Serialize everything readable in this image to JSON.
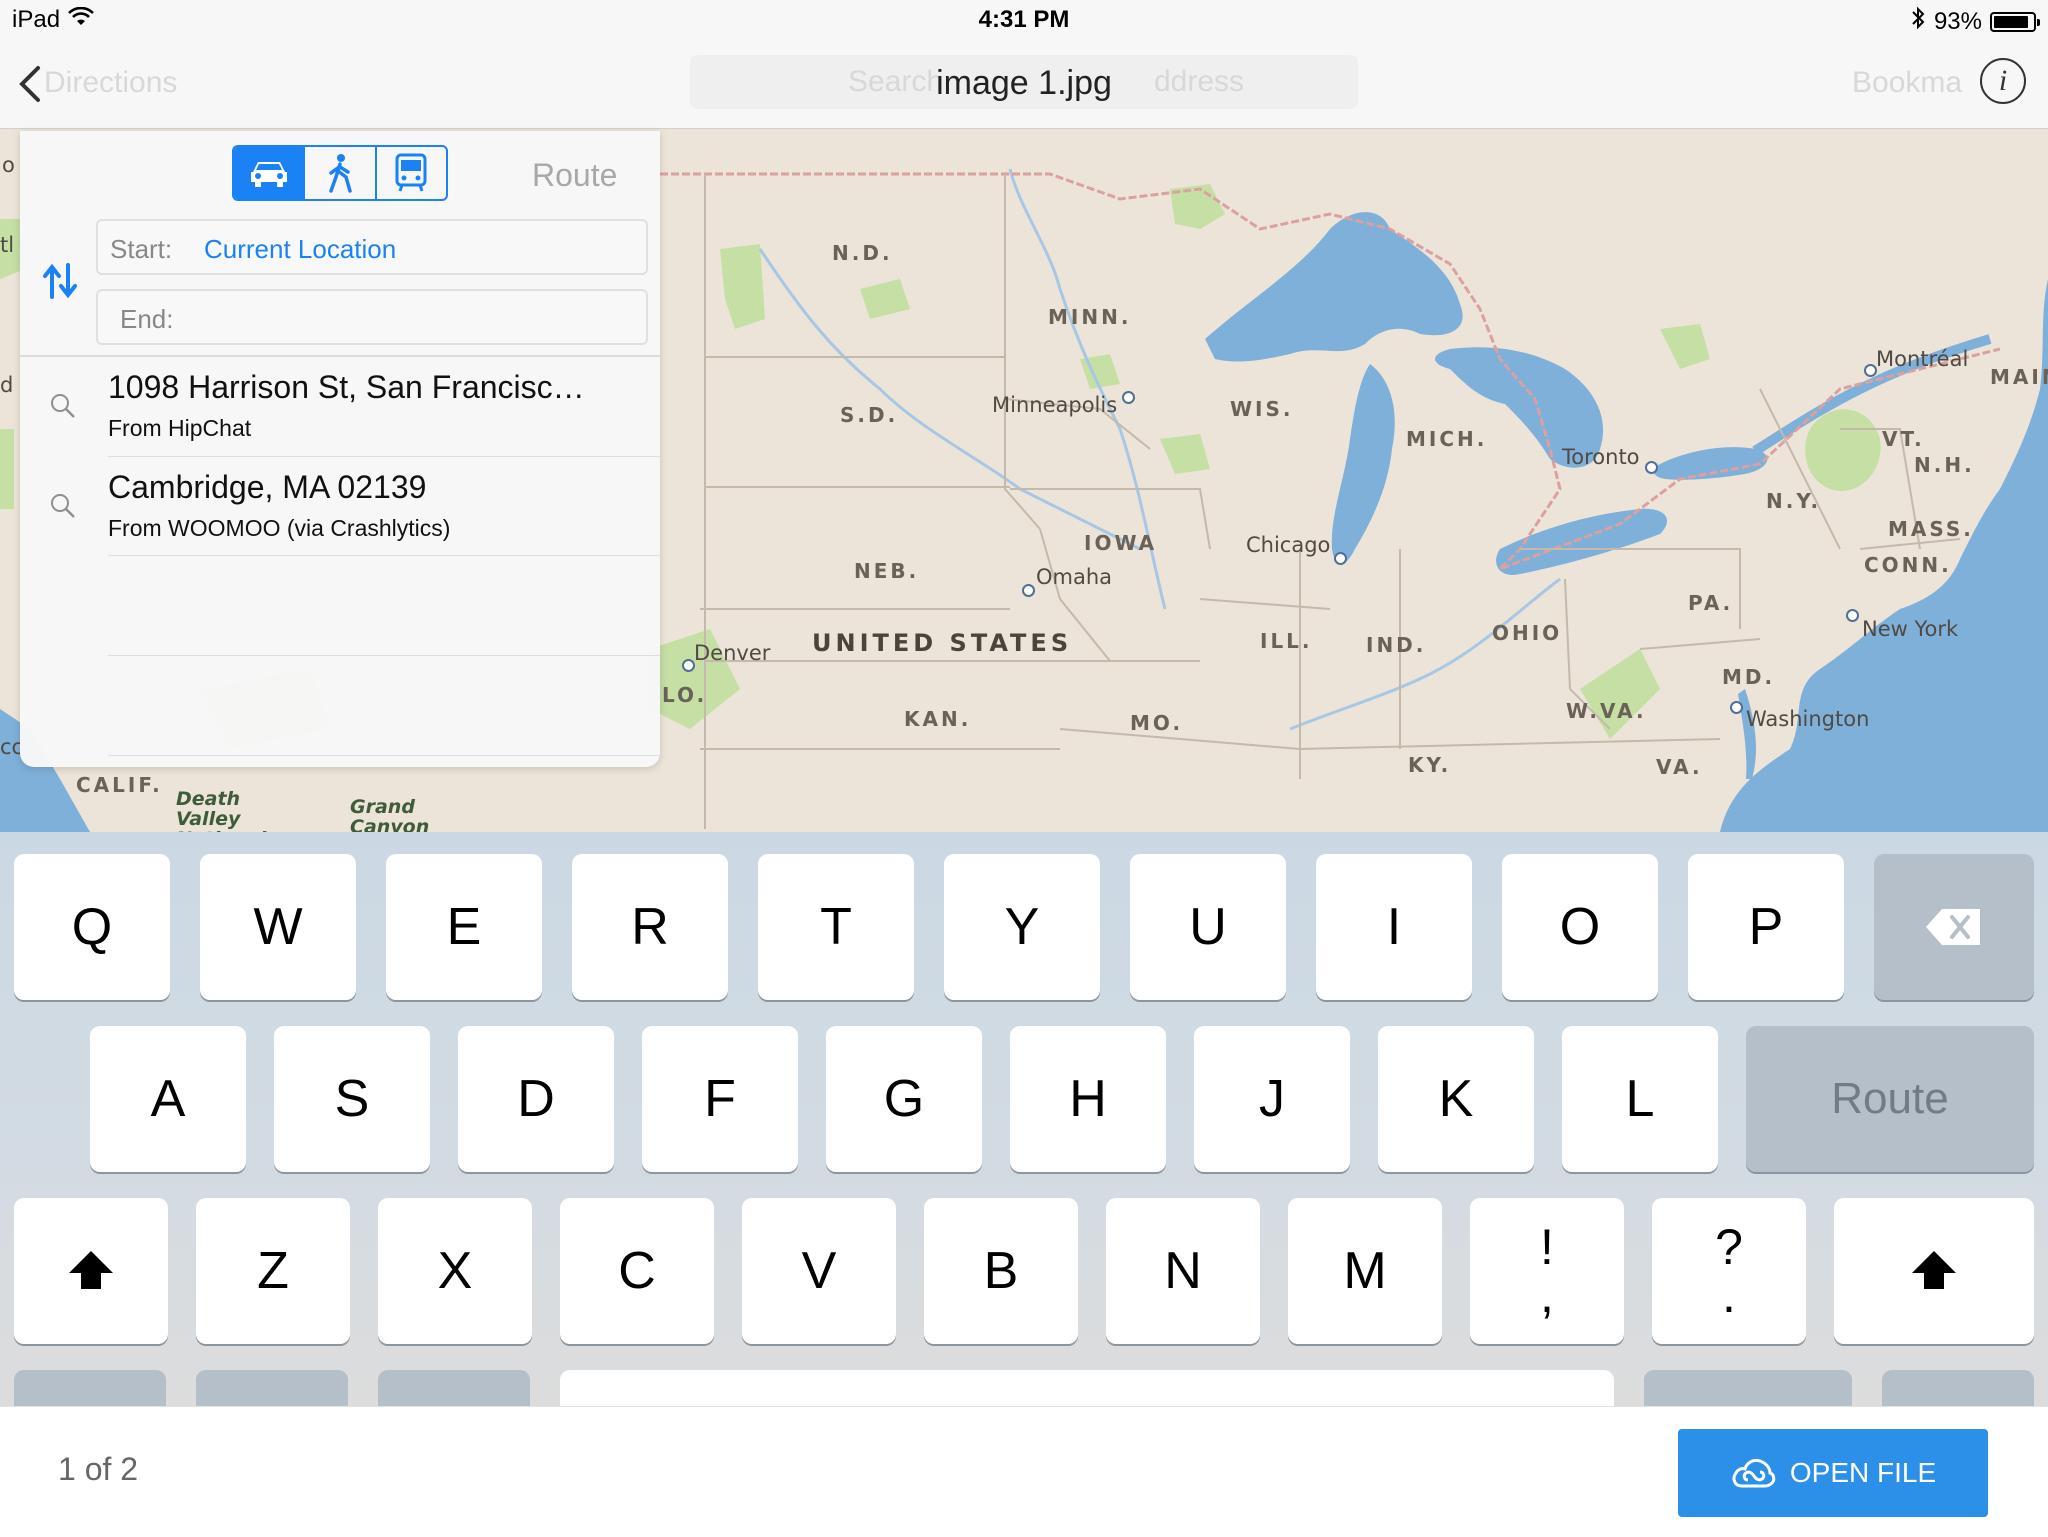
{
  "status_bar": {
    "device": "iPad",
    "time": "4:31 PM",
    "battery": "93%",
    "battery_level": 0.93
  },
  "nav_bar": {
    "title": "image 1.jpg",
    "background_back_label": "Directions",
    "background_search_left": "Search",
    "background_search_right": "ddress",
    "background_right_label": "Bookma"
  },
  "map": {
    "states": [
      "N.D.",
      "MINN.",
      "S.D.",
      "WIS.",
      "MICH.",
      "IOWA",
      "NEB.",
      "ILL.",
      "IND.",
      "OHIO",
      "PA.",
      "N.Y.",
      "VT.",
      "N.H.",
      "MASS.",
      "CONN.",
      "MD.",
      "W.VA.",
      "VA.",
      "KY.",
      "MO.",
      "KAN.",
      "CALIF.",
      "MAIN",
      "LO."
    ],
    "cities": [
      "Minneapolis",
      "Omaha",
      "Chicago",
      "Toronto",
      "Montréal",
      "New York",
      "Washington",
      "Denver"
    ],
    "country": "UNITED STATES",
    "parks": [
      "Death Valley National Park",
      "Grand Canyon National Park"
    ],
    "edge_fragments": [
      "o",
      "tl",
      "d",
      "cc"
    ]
  },
  "directions": {
    "modes": [
      "car",
      "walk",
      "transit"
    ],
    "active_mode": "car",
    "route_label": "Route",
    "start_label": "Start:",
    "start_value": "Current Location",
    "end_label": "End:",
    "end_value": "",
    "results": [
      {
        "title": "1098 Harrison St, San Francisc…",
        "subtitle": "From HipChat"
      },
      {
        "title": "Cambridge, MA 02139",
        "subtitle": "From WOOMOO (via Crashlytics)"
      }
    ]
  },
  "keyboard": {
    "row1": [
      "Q",
      "W",
      "E",
      "R",
      "T",
      "Y",
      "U",
      "I",
      "O",
      "P"
    ],
    "row2": [
      "A",
      "S",
      "D",
      "F",
      "G",
      "H",
      "J",
      "K",
      "L"
    ],
    "row3": [
      "Z",
      "X",
      "C",
      "V",
      "B",
      "N",
      "M"
    ],
    "return_label": "Route",
    "punct1": [
      "!",
      ","
    ],
    "punct2": [
      "?",
      "."
    ]
  },
  "bottom_bar": {
    "pager": "1 of 2",
    "open_file_label": "OPEN FILE"
  },
  "colors": {
    "accent": "#1a82f5",
    "open_button": "#2c8fe8",
    "map_land": "#ece4d8",
    "map_water": "#7fb0d9",
    "map_park": "#c5dfa5"
  }
}
